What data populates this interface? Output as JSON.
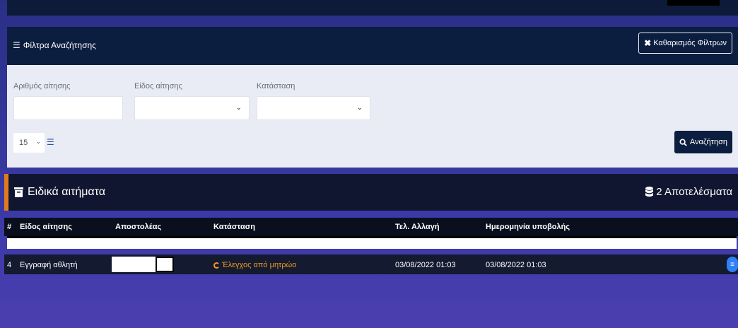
{
  "filters": {
    "title": "Φίλτρα Αναζήτησης",
    "clear_label": "Καθαρισμός Φίλτρων",
    "request_number_label": "Αριθμός αίτησης",
    "request_number_value": "",
    "request_type_label": "Είδος αίτησης",
    "request_type_value": "",
    "status_label": "Κατάσταση",
    "status_value": "",
    "page_size_value": "15",
    "search_label": "Αναζήτηση"
  },
  "results": {
    "title": "Ειδικά αιτήματα",
    "count_label": "2 Αποτελέσματα",
    "columns": [
      "#",
      "Είδος αίτησης",
      "Αποστολέας",
      "Κατάσταση",
      "Τελ. Αλλαγή",
      "Ημερομηνία υποβολής"
    ],
    "rows": [
      {
        "id": "4",
        "type": "Εγγραφή αθλητή",
        "sender": "",
        "status": "Έλεγχος από μητρώο",
        "last_change": "03/08/2022 01:03",
        "submitted": "03/08/2022 01:03"
      }
    ]
  },
  "colors": {
    "accent": "#e07b22",
    "status_pending": "#f09b1f",
    "header_bg": "#0b1e3f",
    "action_blue": "#2f7ff7"
  },
  "icons": [
    "sliders-icon",
    "close-icon",
    "chevron-down-icon",
    "list-icon",
    "search-icon",
    "archive-icon",
    "database-icon",
    "spinner-icon",
    "menu-icon"
  ]
}
